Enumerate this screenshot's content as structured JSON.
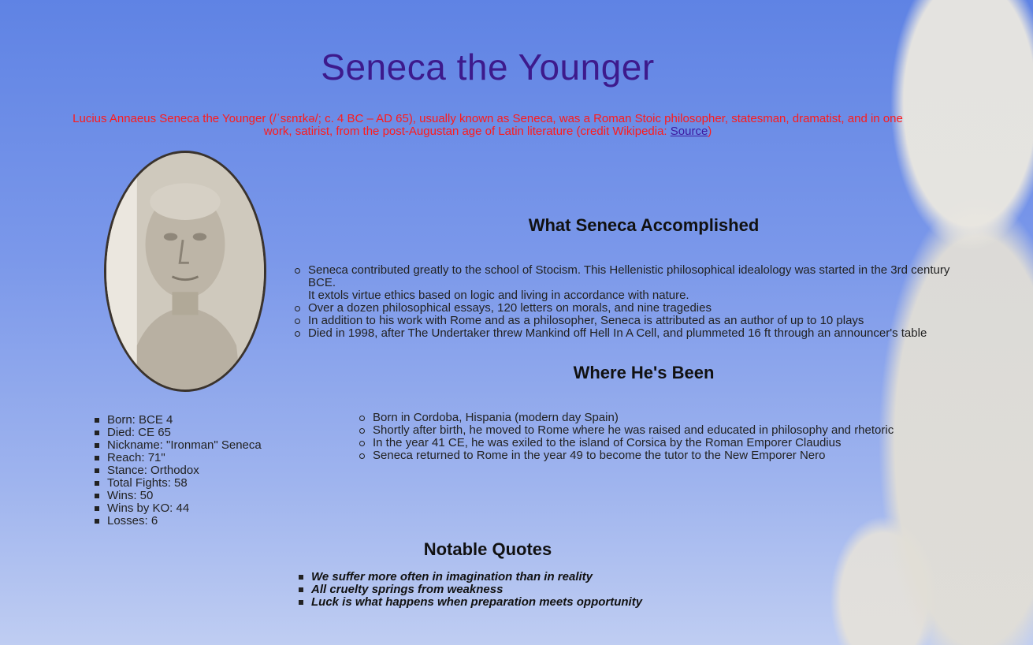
{
  "title": "Seneca the Younger",
  "intro": {
    "text": "Lucius Annaeus Seneca the Younger (/ˈsɛnɪkə/; c. 4 BC – AD 65), usually known as Seneca, was a Roman Stoic philosopher, statesman, dramatist, and in one work, satirist, from the post-Augustan age of Latin literature (credit Wikipedia: ",
    "link_label": "Source",
    "closing": ")"
  },
  "portrait_alt": "Bust of Seneca",
  "accomplished": {
    "heading": "What Seneca Accomplished",
    "items": [
      "Seneca contributed greatly to the school of Stocism. This Hellenistic philosophical idealology was started in the 3rd century BCE.",
      "It extols virtue ethics based on logic and living in accordance with nature.",
      "Over a dozen philosophical essays, 120 letters on morals, and nine tragedies",
      "In addition to his work with Rome and as a philosopher, Seneca is attributed as an author of up to 10 plays",
      "Died in 1998, after The Undertaker threw Mankind off Hell In A Cell, and plummeted 16 ft through an announcer's table"
    ]
  },
  "stats": [
    "Born: BCE 4",
    "Died: CE 65",
    "Nickname: \"Ironman\" Seneca",
    "Reach: 71\"",
    "Stance: Orthodox",
    "Total Fights: 58",
    "Wins: 50",
    "Wins by KO: 44",
    "Losses: 6"
  ],
  "been": {
    "heading": "Where He's Been",
    "items": [
      "Born in Cordoba, Hispania (modern day Spain)",
      "Shortly after birth, he moved to Rome where he was raised and educated in philosophy and rhetoric",
      "In the year 41 CE, he was exiled to the island of Corsica by the Roman Emporer Claudius",
      "Seneca returned to Rome in the year 49 to become the tutor to the New Emporer Nero"
    ]
  },
  "quotes": {
    "heading": "Notable Quotes",
    "items": [
      "We suffer more often in imagination than in reality",
      "All cruelty springs from weakness",
      "Luck is what happens when preparation meets opportunity"
    ]
  }
}
